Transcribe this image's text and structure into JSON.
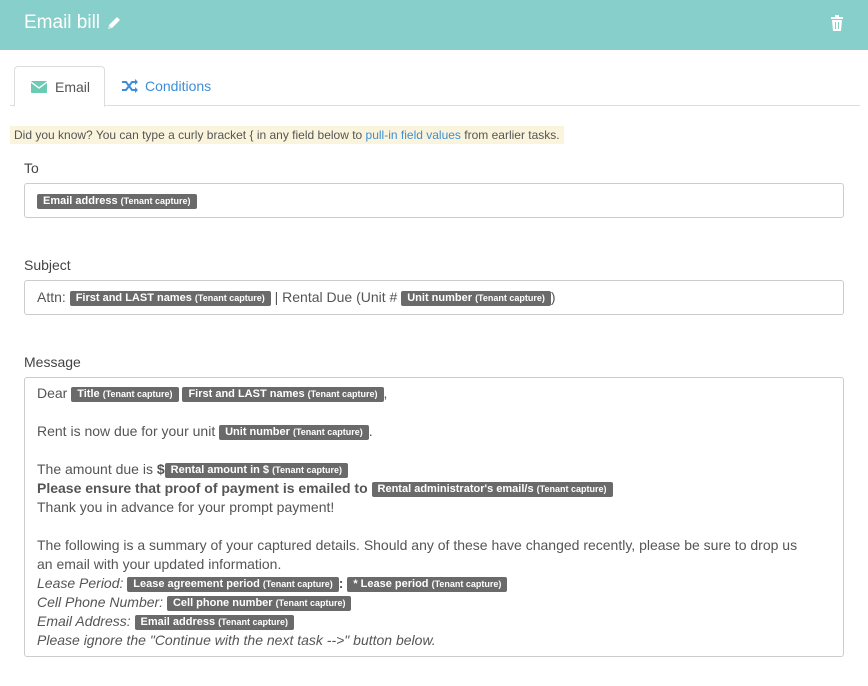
{
  "header": {
    "title": "Email bill",
    "bg_color": "#86cfcb"
  },
  "tabs": {
    "email_label": "Email",
    "conditions_label": "Conditions"
  },
  "tip": {
    "prefix": "Did you know? You can type a curly bracket { in any field below to ",
    "link": "pull-in field values",
    "suffix": " from earlier tasks."
  },
  "to": {
    "label": "To",
    "chip1": {
      "name": "Email address",
      "source": "(Tenant capture)"
    }
  },
  "subject": {
    "label": "Subject",
    "text1": "Attn: ",
    "chip1": {
      "name": "First and LAST names",
      "source": "(Tenant capture)"
    },
    "text2": " | Rental Due (Unit # ",
    "chip2": {
      "name": "Unit number",
      "source": "(Tenant capture)"
    },
    "text3": ")"
  },
  "message": {
    "label": "Message",
    "dear": "Dear ",
    "chip_title": {
      "name": "Title",
      "source": "(Tenant capture)"
    },
    "chip_names": {
      "name": "First and LAST names",
      "source": "(Tenant capture)"
    },
    "comma": ",",
    "rent_text": "Rent is now due for your unit ",
    "chip_unit": {
      "name": "Unit number",
      "source": "(Tenant capture)"
    },
    "period": ".",
    "amount_text": "The amount due is ",
    "dollar": "$",
    "chip_amount": {
      "name": "Rental amount in $",
      "source": "(Tenant capture)"
    },
    "ensure_text": "Please ensure that proof of payment is emailed to ",
    "chip_admin": {
      "name": "Rental administrator's email/s",
      "source": "(Tenant capture)"
    },
    "thanks": "Thank you in advance for your prompt payment!",
    "summary1": "The following is a summary of your captured details. Should any of these have changed recently, please be sure to drop us",
    "summary2": "an email with your updated information.",
    "lease_label": "Lease Period: ",
    "chip_lease_agreement": {
      "name": "Lease agreement period",
      "source": "(Tenant capture)"
    },
    "colon": ":",
    "chip_lease_period": {
      "name": "* Lease period",
      "source": "(Tenant capture)"
    },
    "cell_label": "Cell Phone Number: ",
    "chip_cell": {
      "name": "Cell phone number",
      "source": "(Tenant capture)"
    },
    "email_label": "Email Address: ",
    "chip_email": {
      "name": "Email address",
      "source": "(Tenant capture)"
    },
    "ignore": "Please ignore the \"Continue with the next task -->\" button below."
  }
}
